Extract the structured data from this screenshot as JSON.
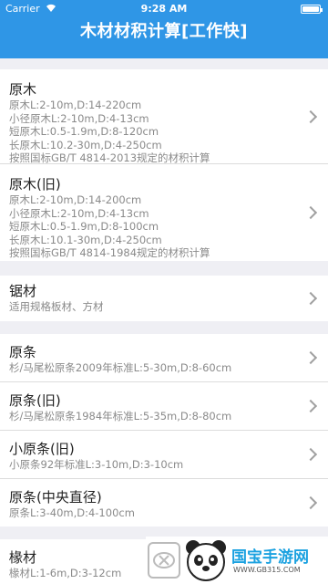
{
  "status_bar": {
    "carrier": "Carrier",
    "time": "9:28 AM"
  },
  "nav": {
    "title": "木材材积计算[工作快]"
  },
  "sections": [
    {
      "items": [
        {
          "title": "原木",
          "details": [
            "原木L:2-10m,D:14-220cm",
            "小径原木L:2-10m,D:4-13cm",
            "短原木L:0.5-1.9m,D:8-120cm",
            "长原木L:10.2-30m,D:4-250cm",
            "按照国标GB/T 4814-2013规定的材积计算"
          ]
        },
        {
          "title": "原木(旧)",
          "details": [
            "原木L:2-10m,D:14-200cm",
            "小径原木L:2-10m,D:4-13cm",
            "短原木L:0.5-1.9m,D:8-100cm",
            "长原木L:10.1-30m,D:4-250cm",
            "按照国标GB/T 4814-1984规定的材积计算"
          ]
        }
      ]
    },
    {
      "items": [
        {
          "title": "锯材",
          "details": [
            "适用规格板材、方材"
          ]
        }
      ]
    },
    {
      "items": [
        {
          "title": "原条",
          "details": [
            "杉/马尾松原条2009年标准L:5-30m,D:8-60cm"
          ]
        },
        {
          "title": "原条(旧)",
          "details": [
            "杉/马尾松原条1984年标准L:5-35m,D:8-80cm"
          ]
        },
        {
          "title": "小原条(旧)",
          "details": [
            "小原条92年标准L:3-10m,D:3-10cm"
          ]
        },
        {
          "title": "原条(中央直径)",
          "details": [
            "原条L:3-40m,D:4-100cm"
          ]
        }
      ]
    },
    {
      "items": [
        {
          "title": "椽材",
          "details": [
            "椽材L:1-6m,D:3-12cm"
          ]
        }
      ]
    }
  ],
  "watermark": {
    "brand": "国宝手游网",
    "site": "WWW.GB315.COM"
  },
  "colors": {
    "nav_background": "#2f96e6",
    "background": "#efeff4"
  }
}
